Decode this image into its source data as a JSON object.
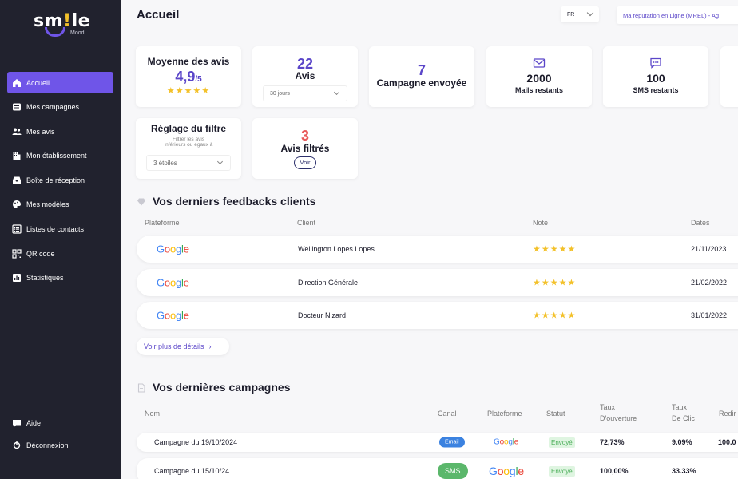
{
  "brand": {
    "logo_main_a": "sm",
    "logo_main_b": "!",
    "logo_main_c": "le",
    "logo_sub": "Mood"
  },
  "nav": {
    "items": [
      {
        "label": "Accueil",
        "icon": "home-icon",
        "active": true
      },
      {
        "label": "Mes campagnes",
        "icon": "campaign-icon"
      },
      {
        "label": "Mes avis",
        "icon": "users-icon"
      },
      {
        "label": "Mon établissement",
        "icon": "building-icon"
      },
      {
        "label": "Boîte de réception",
        "icon": "inbox-icon"
      },
      {
        "label": "Mes modèles",
        "icon": "palette-icon"
      },
      {
        "label": "Listes de contacts",
        "icon": "contacts-icon"
      },
      {
        "label": "QR code",
        "icon": "qr-icon"
      },
      {
        "label": "Statistiques",
        "icon": "chart-icon"
      }
    ],
    "bottom": [
      {
        "label": "Aide",
        "icon": "help-icon"
      },
      {
        "label": "Déconnexion",
        "icon": "logout-icon"
      }
    ]
  },
  "header": {
    "title": "Accueil",
    "lang": "FR",
    "org": "Ma réputation en Ligne (MREL) - Ag"
  },
  "cards": {
    "avg": {
      "title": "Moyenne des avis",
      "value": "4,9",
      "suffix": "/5",
      "stars": "★★★★★"
    },
    "reviews": {
      "value": "22",
      "label": "Avis",
      "period": "30 jours"
    },
    "campaigns": {
      "value": "7",
      "label": "Campagne envoyée"
    },
    "mails": {
      "value": "2000",
      "label": "Mails restants"
    },
    "sms": {
      "value": "100",
      "label": "SMS restants"
    },
    "filter": {
      "title": "Réglage du filtre",
      "desc_1": "Filtrer les avis",
      "desc_2": "inférieurs ou égaux à",
      "value": "3 étoiles"
    },
    "filtered": {
      "value": "3",
      "label": "Avis filtrés",
      "button": "Voir"
    }
  },
  "feedbacks": {
    "title": "Vos derniers feedbacks clients",
    "columns": [
      "Plateforme",
      "Client",
      "Note",
      "Dates"
    ],
    "rows": [
      {
        "platform": "Google",
        "client": "Wellington Lopes Lopes",
        "stars": "★★★★★",
        "date": "21/11/2023"
      },
      {
        "platform": "Google",
        "client": "Direction Générale",
        "stars": "★★★★★",
        "date": "21/02/2022"
      },
      {
        "platform": "Google",
        "client": "Docteur Nizard",
        "stars": "★★★★★",
        "date": "31/01/2022"
      }
    ],
    "more": "Voir plus de détails"
  },
  "campaigns": {
    "title": "Vos dernières campagnes",
    "columns": {
      "name": "Nom",
      "channel": "Canal",
      "platform": "Plateforme",
      "status": "Statut",
      "open_1": "Taux",
      "open_2": "D'ouverture",
      "click_1": "Taux",
      "click_2": "De Clic",
      "redir": "Redir"
    },
    "rows": [
      {
        "name": "Campagne du 19/10/2024",
        "channel": "Email",
        "platform": "Google",
        "status": "Envoyé",
        "open": "72,73%",
        "click": "9.09%",
        "redir": "100.0"
      },
      {
        "name": "Campagne du 15/10/24",
        "channel": "SMS",
        "platform": "Google",
        "status": "Envoyé",
        "open": "100,00%",
        "click": "33.33%",
        "redir": ""
      }
    ]
  },
  "colors": {
    "accent": "#6f55e8",
    "sidebar": "#21222e",
    "star": "#f3c12a",
    "email_pill": "#3b82e0",
    "sms_pill": "#5bb76b"
  }
}
